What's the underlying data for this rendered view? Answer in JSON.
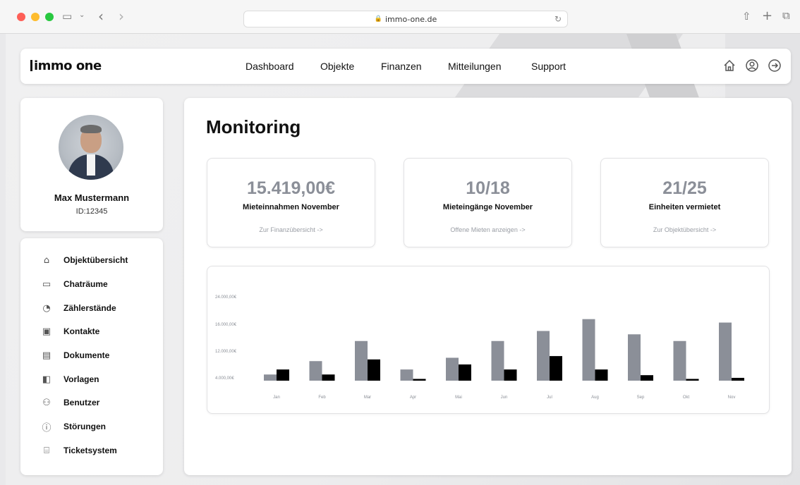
{
  "browser": {
    "url": "immo-one.de",
    "lock_icon": "🔒",
    "reload_icon": "↻",
    "sidebar_toggle_icon": "▭",
    "back_icon": "‹",
    "forward_icon": "›",
    "share_icon": "⇧",
    "new_tab_icon": "+",
    "tabs_icon": "⧉"
  },
  "header": {
    "logo_text": "immo one",
    "nav": [
      "Dashboard",
      "Objekte",
      "Finanzen",
      "Mitteilungen",
      "Support"
    ],
    "icons": [
      "home-icon",
      "account-icon",
      "logout-icon"
    ]
  },
  "profile": {
    "name": "Max Mustermann",
    "id": "ID:12345"
  },
  "sidebar": {
    "items": [
      {
        "label": "Objektübersicht",
        "icon": "home-icon",
        "glyph": "⌂"
      },
      {
        "label": "Chaträume",
        "icon": "chat-icon",
        "glyph": "▭"
      },
      {
        "label": "Zählerstände",
        "icon": "meter-icon",
        "glyph": "◔"
      },
      {
        "label": "Kontakte",
        "icon": "contact-icon",
        "glyph": "▣"
      },
      {
        "label": "Dokumente",
        "icon": "document-icon",
        "glyph": "▤"
      },
      {
        "label": "Vorlagen",
        "icon": "template-icon",
        "glyph": "◧"
      },
      {
        "label": "Benutzer",
        "icon": "users-icon",
        "glyph": "⚇"
      },
      {
        "label": "Störungen",
        "icon": "alert-icon",
        "glyph": "ⓘ"
      },
      {
        "label": "Ticketsystem",
        "icon": "ticket-icon",
        "glyph": "⌸"
      }
    ]
  },
  "main": {
    "title": "Monitoring",
    "stats": [
      {
        "value": "15.419,00€",
        "label": "Mieteinnahmen November",
        "link": "Zur Finanzübersicht ->"
      },
      {
        "value": "10/18",
        "label": "Mieteingänge November",
        "link": "Offene Mieten anzeigen ->"
      },
      {
        "value": "21/25",
        "label": "Einheiten vermietet",
        "link": "Zur Objektübersicht ->"
      }
    ]
  },
  "colors": {
    "accent_gray": "#8b8f98",
    "bar_black": "#000000"
  },
  "chart_data": {
    "type": "bar",
    "categories": [
      "Jan",
      "Feb",
      "Mar",
      "Apr",
      "Mai",
      "Jun",
      "Jul",
      "Aug",
      "Sep",
      "Okt",
      "Nov"
    ],
    "y_tick_labels": [
      "24.000,00€",
      "16.000,00€",
      "12.000,00€",
      "4.000,00€"
    ],
    "y_ticks": [
      24000,
      16000,
      12000,
      4000
    ],
    "ylim": [
      0,
      24000
    ],
    "series": [
      {
        "color": "#8b8f98",
        "values": [
          5000,
          9000,
          13500,
          6500,
          10000,
          13500,
          15000,
          17500,
          14500,
          13500,
          16500
        ]
      },
      {
        "color": "#000000",
        "values": [
          6500,
          5000,
          9500,
          2500,
          8000,
          6500,
          10500,
          6500,
          4800,
          2500,
          4000
        ]
      }
    ],
    "grid": false,
    "legend": "none"
  }
}
